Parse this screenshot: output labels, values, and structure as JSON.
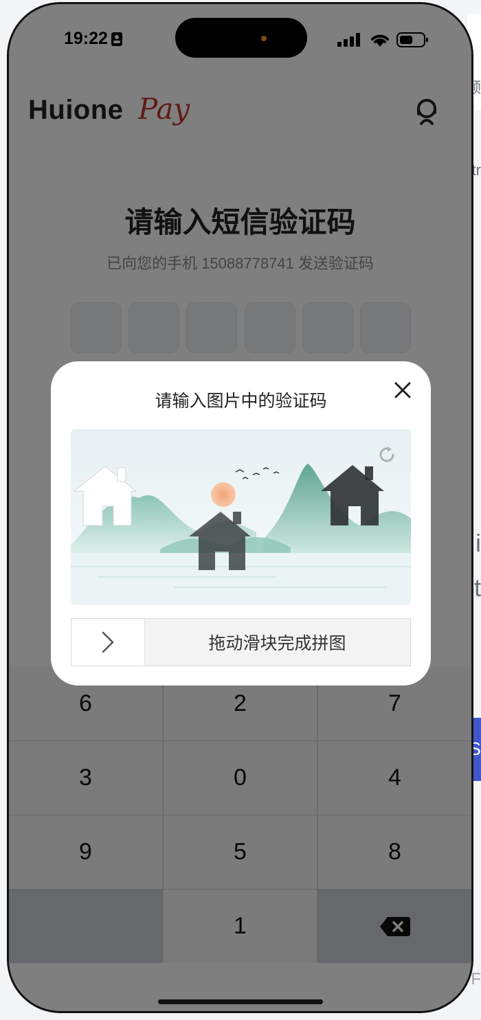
{
  "status_bar": {
    "time": "19:22"
  },
  "app": {
    "logo_main": "Huione",
    "logo_accent": "Pay",
    "heading": "请输入短信验证码",
    "subtitle": "已向您的手机 15088778741 发送验证码",
    "code_boxes": [
      "",
      "",
      "",
      "",
      "",
      ""
    ]
  },
  "keypad": {
    "keys": [
      "6",
      "2",
      "7",
      "3",
      "0",
      "4",
      "9",
      "5",
      "8",
      "",
      "1",
      "⌫"
    ]
  },
  "modal": {
    "title": "请输入图片中的验证码",
    "slider_text": "拖动滑块完成拼图"
  },
  "background_page": {
    "fragments": [
      "频",
      "tr",
      "i",
      "t",
      "S",
      "F"
    ]
  }
}
